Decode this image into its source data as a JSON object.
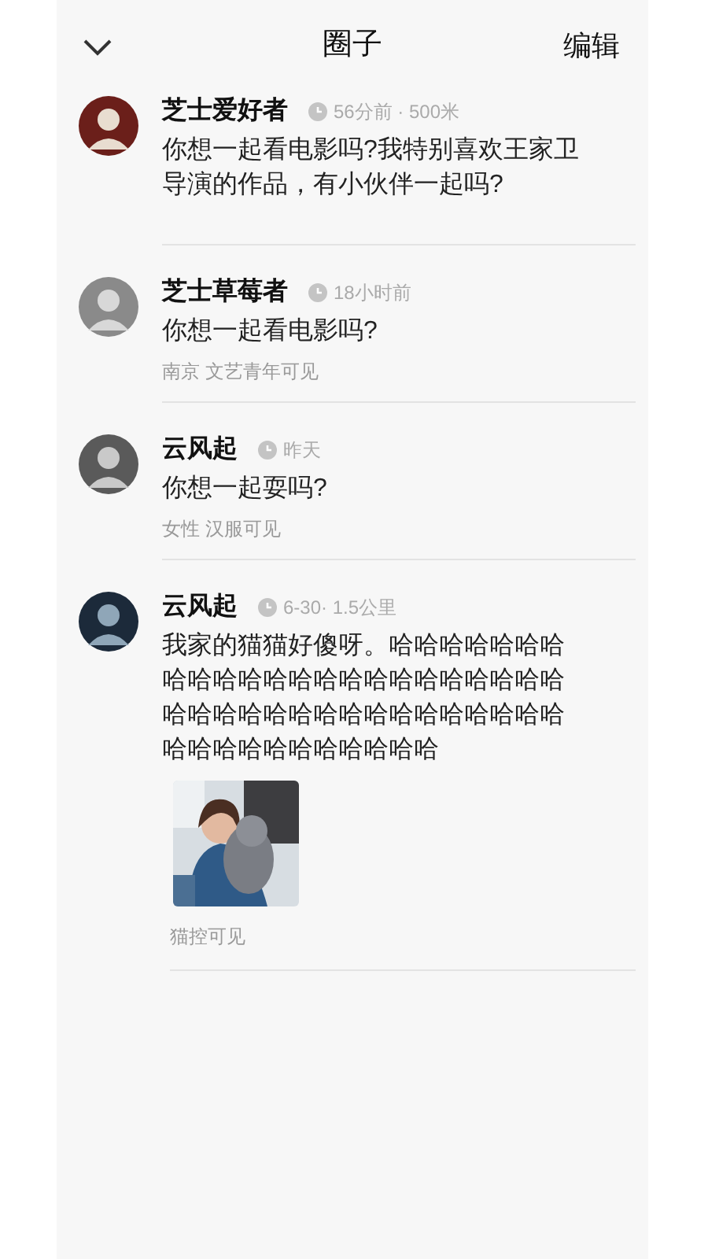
{
  "header": {
    "title": "圈子",
    "action": "编辑"
  },
  "posts": [
    {
      "name": "芝士爱好者",
      "meta": "56分前 · 500米",
      "text": "你想一起看电影吗?我特别喜欢王家卫导演的作品，有小伙伴一起吗?"
    },
    {
      "name": "芝士草莓者",
      "meta": "18小时前",
      "text": "你想一起看电影吗?",
      "tag": "南京 文艺青年可见"
    },
    {
      "name": "云风起",
      "meta": "昨天",
      "text": "你想一起耍吗?",
      "tag": "女性 汉服可见"
    },
    {
      "name": "云风起",
      "meta": "6-30· 1.5公里",
      "text": "我家的猫猫好傻呀。哈哈哈哈哈哈哈哈哈哈哈哈哈哈哈哈哈哈哈哈哈哈哈哈哈哈哈哈哈哈哈哈哈哈哈哈哈哈哈哈哈哈哈哈哈哈哈哈哈哈",
      "tag": "猫控可见"
    }
  ]
}
